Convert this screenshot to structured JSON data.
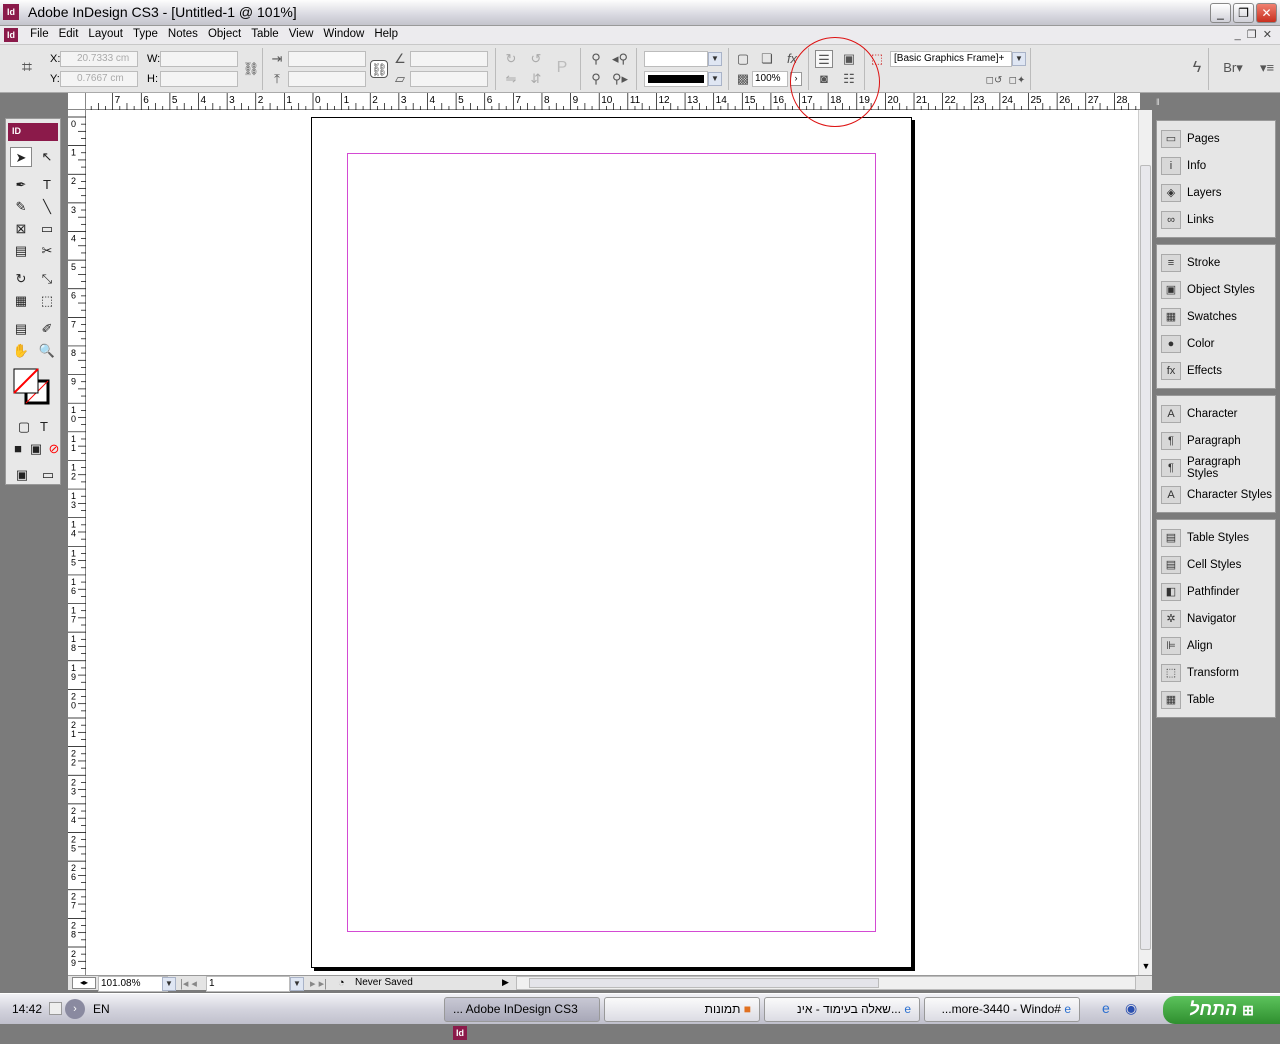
{
  "window": {
    "title": "Adobe InDesign CS3 - [Untitled-1 @ 101%]",
    "app_icon": "Id"
  },
  "menu": [
    "File",
    "Edit",
    "Layout",
    "Type",
    "Notes",
    "Object",
    "Table",
    "View",
    "Window",
    "Help"
  ],
  "control": {
    "x_label": "X:",
    "x_value": "20.7333 cm",
    "y_label": "Y:",
    "y_value": "0.7667 cm",
    "w_label": "W:",
    "h_label": "H:",
    "opacity": "100%",
    "object_style": "[Basic Graphics Frame]+"
  },
  "ruler": {
    "top": [
      "7",
      "6",
      "5",
      "4",
      "3",
      "2",
      "1",
      "0",
      "1",
      "2",
      "3",
      "4",
      "5",
      "6",
      "7",
      "8",
      "9",
      "10",
      "11",
      "12",
      "13",
      "14",
      "15",
      "16",
      "17",
      "18",
      "19",
      "20",
      "21",
      "22",
      "23",
      "24",
      "25",
      "26",
      "27",
      "28"
    ],
    "left": [
      "0",
      "1",
      "2",
      "3",
      "4",
      "5",
      "6",
      "7",
      "8",
      "9",
      "10",
      "11",
      "12",
      "13",
      "14",
      "15",
      "16",
      "17",
      "18",
      "19",
      "20",
      "21",
      "22",
      "23",
      "24",
      "25",
      "26",
      "27",
      "28",
      "29"
    ]
  },
  "status": {
    "zoom": "101.08%",
    "page": "1",
    "save_state": "Never Saved"
  },
  "panels": [
    [
      {
        "label": "Pages",
        "icon": "▭"
      },
      {
        "label": "Info",
        "icon": "i"
      },
      {
        "label": "Layers",
        "icon": "◈"
      },
      {
        "label": "Links",
        "icon": "∞"
      }
    ],
    [
      {
        "label": "Stroke",
        "icon": "≡"
      },
      {
        "label": "Object Styles",
        "icon": "▣"
      },
      {
        "label": "Swatches",
        "icon": "▦"
      },
      {
        "label": "Color",
        "icon": "●"
      },
      {
        "label": "Effects",
        "icon": "fx"
      }
    ],
    [
      {
        "label": "Character",
        "icon": "A"
      },
      {
        "label": "Paragraph",
        "icon": "¶"
      },
      {
        "label": "Paragraph Styles",
        "icon": "¶"
      },
      {
        "label": "Character Styles",
        "icon": "A"
      }
    ],
    [
      {
        "label": "Table Styles",
        "icon": "▤"
      },
      {
        "label": "Cell Styles",
        "icon": "▤"
      },
      {
        "label": "Pathfinder",
        "icon": "◧"
      },
      {
        "label": "Navigator",
        "icon": "✲"
      },
      {
        "label": "Align",
        "icon": "⊫"
      },
      {
        "label": "Transform",
        "icon": "⬚"
      },
      {
        "label": "Table",
        "icon": "▦"
      }
    ]
  ],
  "taskbar": {
    "clock": "14:42",
    "lang": "EN",
    "tasks": [
      "... Adobe InDesign CS3",
      "תמונות",
      "שאלה בעימוד - אינ...",
      "...more-3440 - Windo#"
    ],
    "start": "התחל"
  }
}
